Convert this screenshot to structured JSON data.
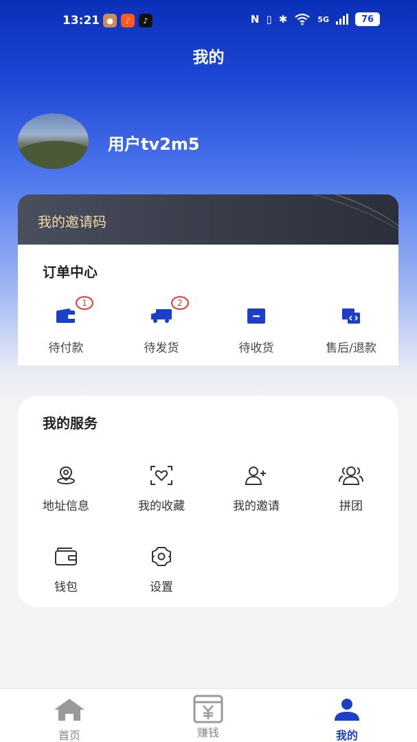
{
  "status_bar": {
    "time": "13:21",
    "battery": "76",
    "network": "5G"
  },
  "header": {
    "title": "我的"
  },
  "profile": {
    "username": "用户tv2m5"
  },
  "invite": {
    "label": "我的邀请码"
  },
  "orders": {
    "title": "订单中心",
    "items": [
      {
        "label": "待付款",
        "icon": "wallet-icon",
        "badge": "1"
      },
      {
        "label": "待发货",
        "icon": "truck-icon",
        "badge": "2"
      },
      {
        "label": "待收货",
        "icon": "box-icon",
        "badge": ""
      },
      {
        "label": "售后/退款",
        "icon": "refund-icon",
        "badge": ""
      }
    ]
  },
  "services": {
    "title": "我的服务",
    "items": [
      {
        "label": "地址信息",
        "icon": "location-icon"
      },
      {
        "label": "我的收藏",
        "icon": "favorite-icon"
      },
      {
        "label": "我的邀请",
        "icon": "add-user-icon"
      },
      {
        "label": "拼团",
        "icon": "group-icon"
      },
      {
        "label": "钱包",
        "icon": "wallet-outline-icon"
      },
      {
        "label": "设置",
        "icon": "gear-icon"
      }
    ]
  },
  "tabs": [
    {
      "label": "首页",
      "icon": "home-icon"
    },
    {
      "label": "赚钱",
      "icon": "yen-icon"
    },
    {
      "label": "我的",
      "icon": "person-icon",
      "active": true
    }
  ],
  "colors": {
    "brand": "#1b3fc9",
    "badge": "#e53935",
    "invite_text": "#f2d9a8"
  }
}
